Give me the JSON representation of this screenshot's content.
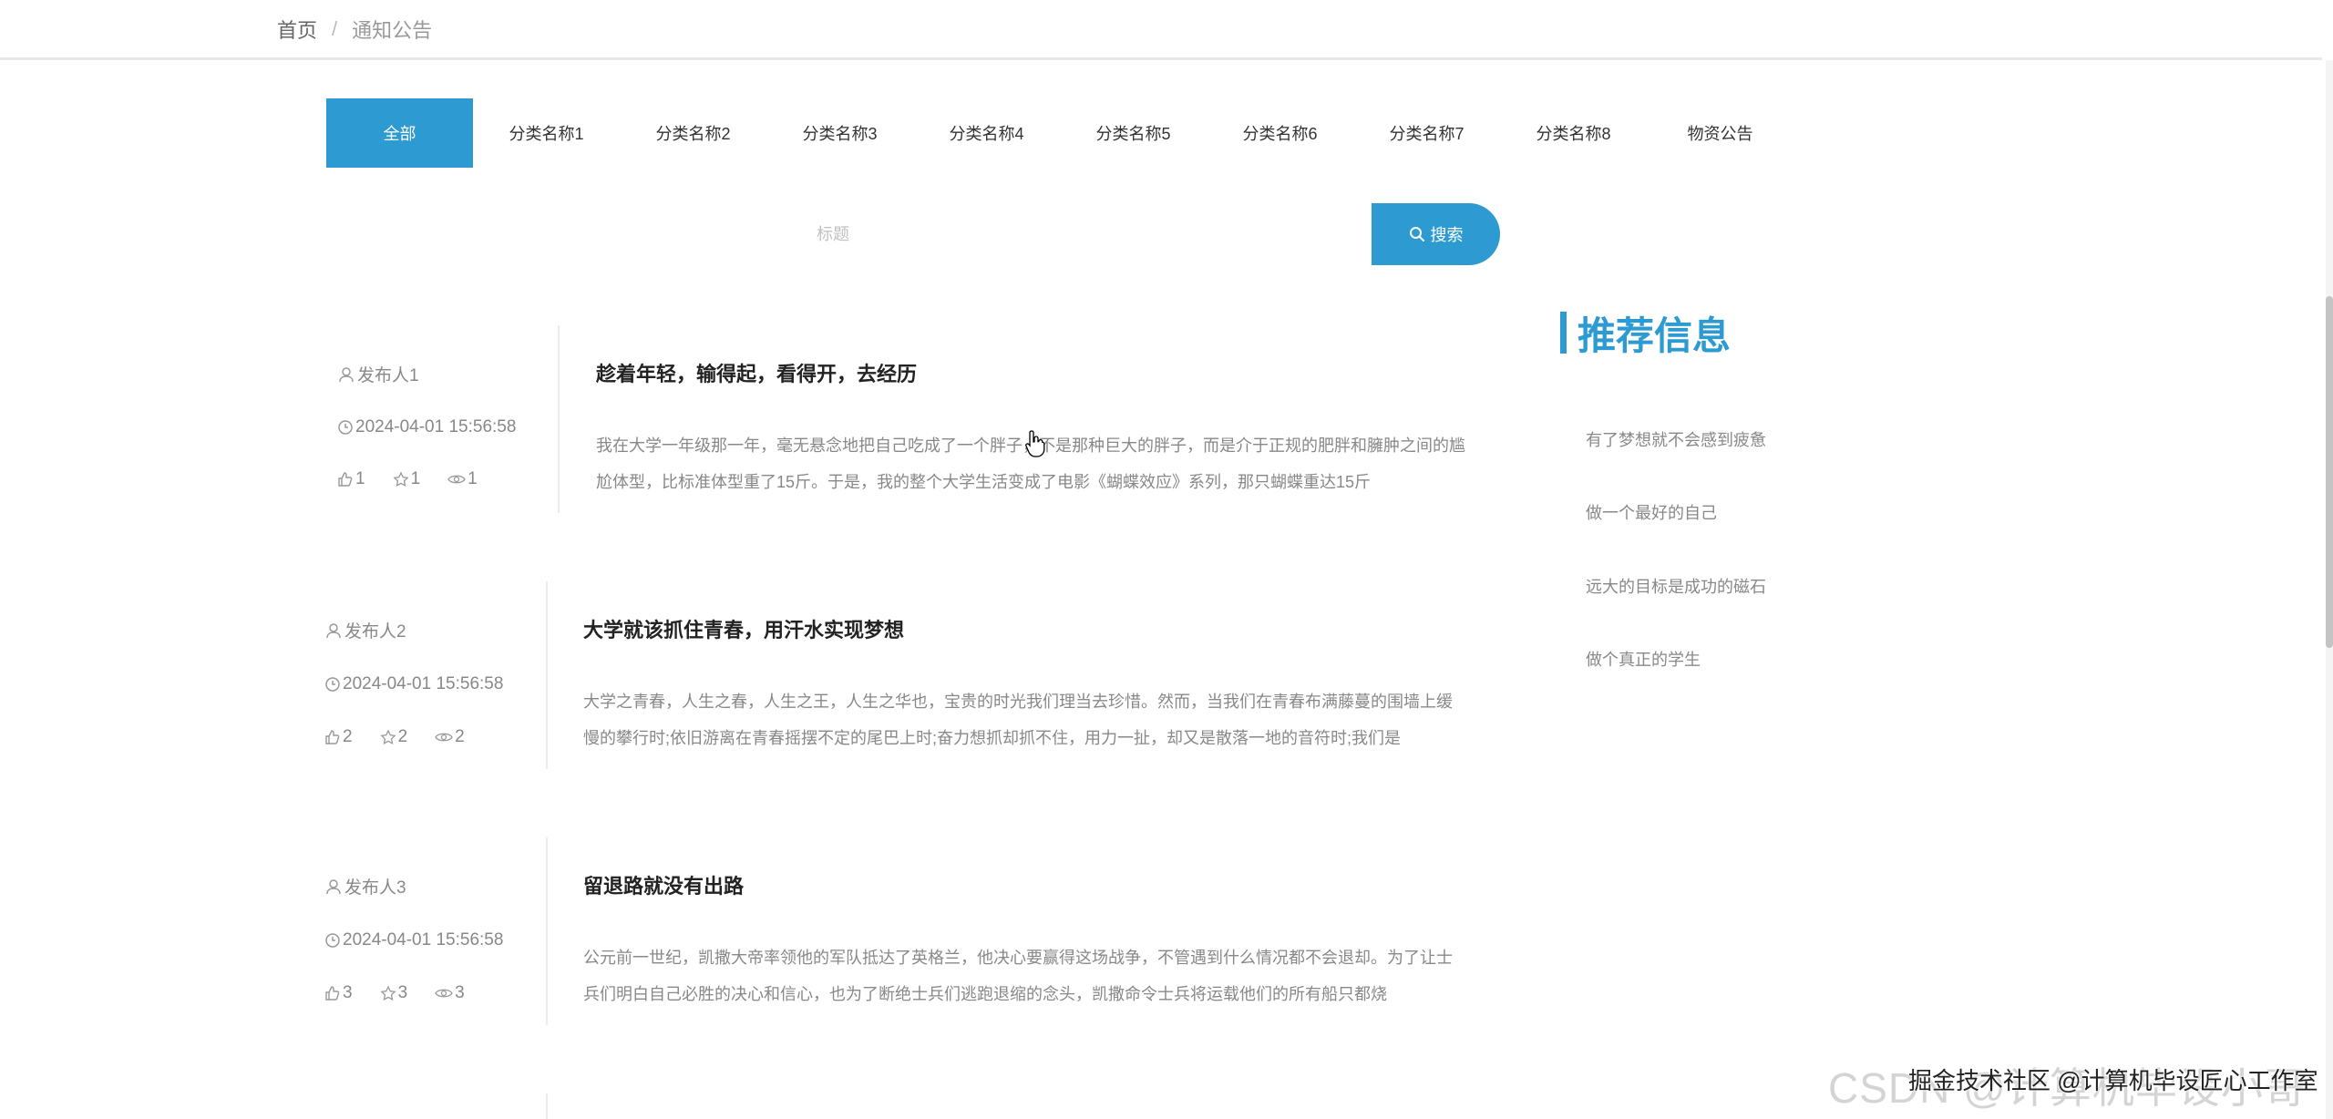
{
  "breadcrumb": {
    "home": "首页",
    "separator": "/",
    "current": "通知公告"
  },
  "tabs": [
    {
      "label": "全部",
      "active": true
    },
    {
      "label": "分类名称1",
      "active": false
    },
    {
      "label": "分类名称2",
      "active": false
    },
    {
      "label": "分类名称3",
      "active": false
    },
    {
      "label": "分类名称4",
      "active": false
    },
    {
      "label": "分类名称5",
      "active": false
    },
    {
      "label": "分类名称6",
      "active": false
    },
    {
      "label": "分类名称7",
      "active": false
    },
    {
      "label": "分类名称8",
      "active": false
    },
    {
      "label": "物资公告",
      "active": false
    }
  ],
  "search": {
    "placeholder": "标题",
    "value": "",
    "button_label": "搜索"
  },
  "articles": [
    {
      "author": "发布人1",
      "time": "2024-04-01 15:56:58",
      "likes": "1",
      "favorites": "1",
      "views": "1",
      "title": "趁着年轻，输得起，看得开，去经历",
      "summary": "我在大学一年级那一年，毫无悬念地把自己吃成了一个胖子，不是那种巨大的胖子，而是介于正规的肥胖和臃肿之间的尴尬体型，比标准体型重了15斤。于是，我的整个大学生活变成了电影《蝴蝶效应》系列，那只蝴蝶重达15斤"
    },
    {
      "author": "发布人2",
      "time": "2024-04-01 15:56:58",
      "likes": "2",
      "favorites": "2",
      "views": "2",
      "title": "大学就该抓住青春，用汗水实现梦想",
      "summary": "大学之青春，人生之春，人生之王，人生之华也，宝贵的时光我们理当去珍惜。然而，当我们在青春布满藤蔓的围墙上缓慢的攀行时;依旧游离在青春摇摆不定的尾巴上时;奋力想抓却抓不住，用力一扯，却又是散落一地的音符时;我们是"
    },
    {
      "author": "发布人3",
      "time": "2024-04-01 15:56:58",
      "likes": "3",
      "favorites": "3",
      "views": "3",
      "title": "留退路就没有出路",
      "summary": "公元前一世纪，凯撒大帝率领他的军队抵达了英格兰，他决心要赢得这场战争，不管遇到什么情况都不会退却。为了让士兵们明白自己必胜的决心和信心，也为了断绝士兵们逃跑退缩的念头，凯撒命令士兵将运载他们的所有船只都烧"
    }
  ],
  "recommend": {
    "title": "推荐信息",
    "items": [
      "有了梦想就不会感到疲惫",
      "做一个最好的自己",
      "远大的目标是成功的磁石",
      "做个真正的学生"
    ]
  },
  "watermark": "CSDN @计算机毕设小哥",
  "credit": "掘金技术社区 @计算机毕设匠心工作室",
  "colors": {
    "accent": "#2d9bd2",
    "text_muted": "#888888",
    "title": "#222222"
  },
  "icons": {
    "author": "user-icon",
    "time": "clock-icon",
    "likes": "thumbs-up-icon",
    "favorites": "star-icon",
    "views": "eye-icon",
    "search": "search-icon",
    "cursor": "hand-pointer-icon"
  }
}
